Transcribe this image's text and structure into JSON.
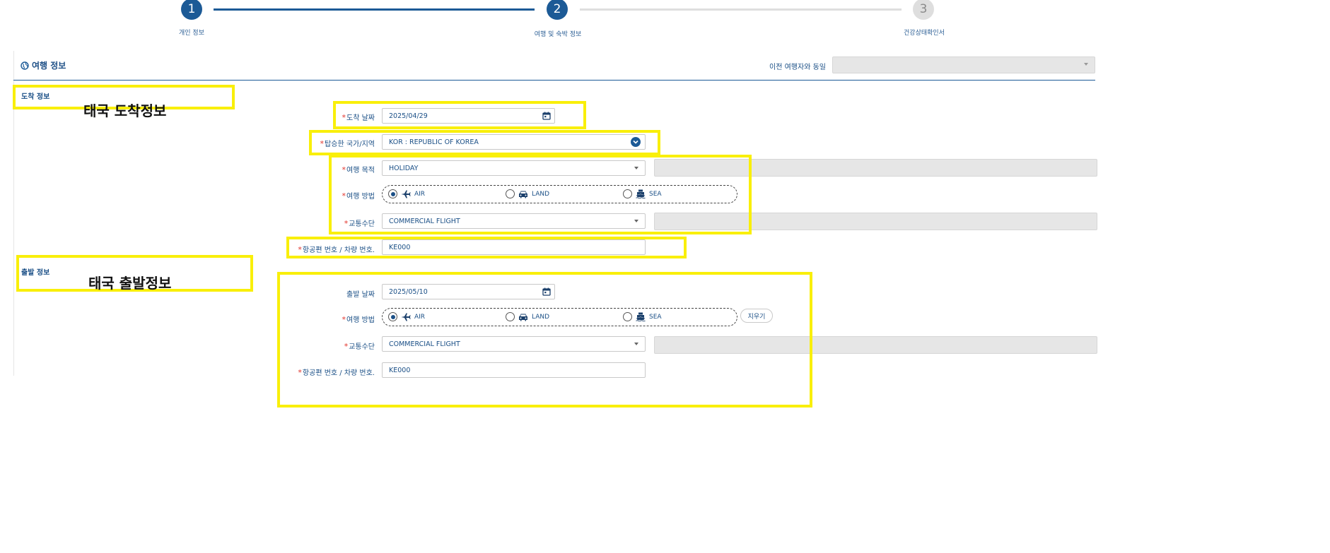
{
  "stepper": {
    "steps": [
      {
        "number": "1",
        "label": "개인 정보"
      },
      {
        "number": "2",
        "label": "여행 및 숙박 정보"
      },
      {
        "number": "3",
        "label": "건강상태확인서"
      }
    ]
  },
  "section": {
    "title": "여행 정보",
    "prev_traveler_label": "이전 여행자와 동일",
    "prev_traveler_value": ""
  },
  "arrival": {
    "subtitle": "도착 정보",
    "annotation": "태국 도착정보",
    "date_label": "도착 날짜",
    "date_value": "2025/04/29",
    "country_label": "탑승한 국가/지역",
    "country_value": "KOR : REPUBLIC OF KOREA",
    "purpose_label": "여행 목적",
    "purpose_value": "HOLIDAY",
    "method_label": "여행 방법",
    "method_options": [
      "AIR",
      "LAND",
      "SEA"
    ],
    "method_selected": "AIR",
    "transport_label": "교통수단",
    "transport_value": "COMMERCIAL FLIGHT",
    "flight_label": "항공편 번호 / 차량 번호.",
    "flight_value": "KE000"
  },
  "departure": {
    "subtitle": "출발 정보",
    "annotation": "태국 출발정보",
    "date_label": "출발 날짜",
    "date_value": "2025/05/10",
    "method_label": "여행 방법",
    "method_options": [
      "AIR",
      "LAND",
      "SEA"
    ],
    "method_selected": "AIR",
    "clear_button": "지우기",
    "transport_label": "교통수단",
    "transport_value": "COMMERCIAL FLIGHT",
    "flight_label": "항공편 번호 / 차량 번호.",
    "flight_value": "KE000"
  },
  "colors": {
    "primary": "#1c5a96",
    "highlight": "#f9ef0a",
    "required": "#e1332b"
  }
}
